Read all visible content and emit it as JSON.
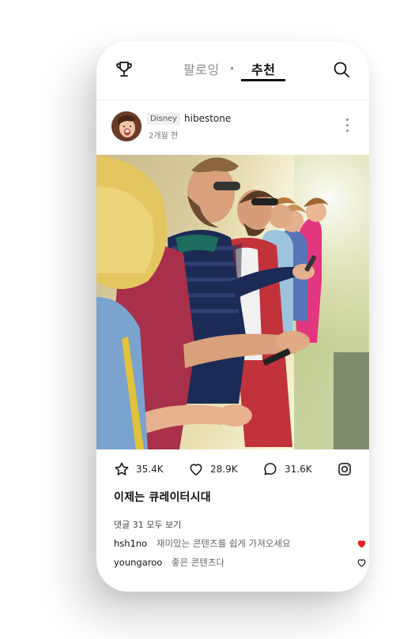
{
  "topbar": {
    "tabs": [
      {
        "label": "팔로잉",
        "active": false
      },
      {
        "label": "추천",
        "active": true
      }
    ]
  },
  "post": {
    "brand": "Disney",
    "username": "hibestone",
    "time": "2개월 전",
    "stats": {
      "likes": "35.4K",
      "hearts": "28.9K",
      "comments": "31.6K"
    },
    "caption": "이제는 큐레이터시대",
    "comments_link": "댓글 31 모두 보기",
    "comments": [
      {
        "user": "hsh1no",
        "text": "재미있는 콘텐츠를 쉽게 가져오세요",
        "liked": true
      },
      {
        "user": "youngaroo",
        "text": "좋은 콘텐츠다",
        "liked": false
      }
    ]
  },
  "colors": {
    "liked_heart": "#e32222",
    "active_tab": "#111111",
    "inactive_tab": "#8a8a8a"
  },
  "icons": [
    "trophy-icon",
    "search-icon",
    "more-icon",
    "star-icon",
    "heart-icon",
    "comment-icon",
    "instagram-icon"
  ]
}
